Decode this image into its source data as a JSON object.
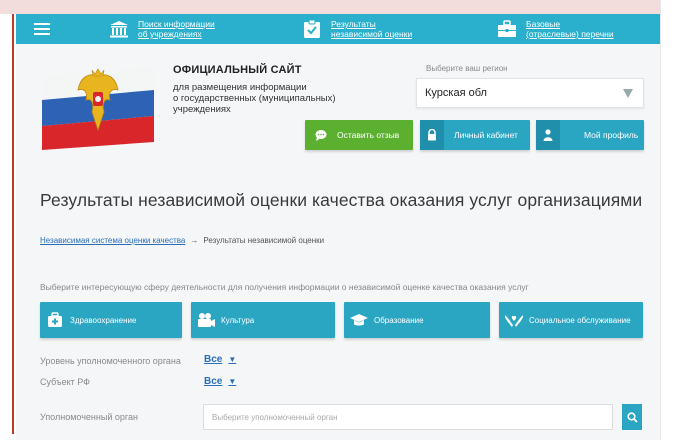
{
  "nav": {
    "items": [
      {
        "label": "Поиск информации\nоб учреждениях",
        "icon": "building-icon"
      },
      {
        "label": "Результаты\nнезависимой оценки",
        "icon": "clipboard-check-icon"
      },
      {
        "label": "Базовые\n(отраслевые) перечни",
        "icon": "briefcase-icon"
      }
    ]
  },
  "site": {
    "title": "ОФИЦИАЛЬНЫЙ САЙТ",
    "description": "для размещения информации\nо государственных (муниципальных)\nучреждениях"
  },
  "region": {
    "label": "Выберите ваш регион",
    "value": "Курская обл"
  },
  "header_buttons": {
    "feedback": "Оставить отзыв",
    "cabinet": "Личный кабинет",
    "profile": "Мой профиль"
  },
  "page_title": "Результаты независимой оценки качества оказания услуг организациями",
  "breadcrumb": {
    "link": "Независимая система оценки качества",
    "separator": "→",
    "current": "Результаты независимой оценки"
  },
  "spheres": {
    "prompt": "Выберите интересующую сферу деятельности для получения информации о независимой оценке качества оказания услуг",
    "items": [
      {
        "label": "Здравоохранение",
        "icon": "medical-case-icon"
      },
      {
        "label": "Культура",
        "icon": "theater-camera-icon"
      },
      {
        "label": "Образование",
        "icon": "graduation-cap-icon"
      },
      {
        "label": "Социальное обслуживание",
        "icon": "heart-hands-icon"
      }
    ]
  },
  "filters": {
    "level_label": "Уровень уполномоченного органа",
    "level_value": "Все",
    "subject_label": "Субъект РФ",
    "subject_value": "Все",
    "organ_label": "Уполномоченный орган",
    "organ_placeholder": "Выберите уполномоченный орган"
  },
  "colors": {
    "nav": "#2ab0cc",
    "primary_button": "#2aa5c2",
    "feedback_button": "#5cb030",
    "link": "#2a6fb5"
  }
}
